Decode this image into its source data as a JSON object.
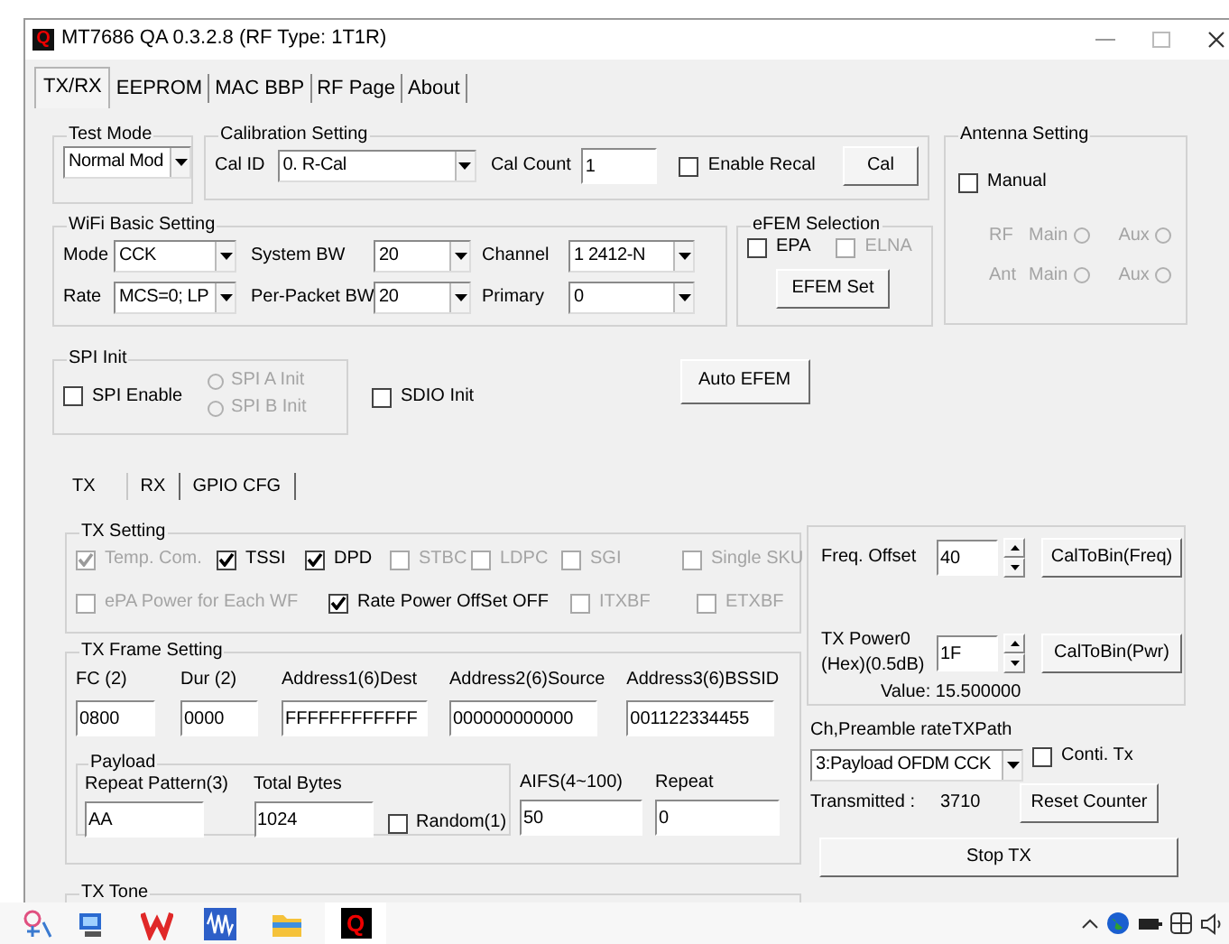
{
  "window": {
    "title": "MT7686 QA 0.3.2.8  (RF Type: 1T1R)",
    "icon_letter": "Q"
  },
  "tabs": [
    {
      "label": "TX/RX",
      "selected": true
    },
    {
      "label": "EEPROM",
      "selected": false
    },
    {
      "label": "MAC  BBP",
      "selected": false
    },
    {
      "label": "RF Page",
      "selected": false
    },
    {
      "label": "About",
      "selected": false
    }
  ],
  "test_mode": {
    "title": "Test Mode",
    "value": "Normal Mod"
  },
  "calibration": {
    "title": "Calibration Setting",
    "cal_id_label": "Cal ID",
    "cal_id": "0. R-Cal",
    "cal_count_label": "Cal Count",
    "cal_count": "1",
    "enable_recal": {
      "label": "Enable Recal",
      "checked": false
    },
    "button": "Cal"
  },
  "antenna": {
    "title": "Antenna Setting",
    "manual": {
      "label": "Manual",
      "checked": false
    },
    "rows": [
      {
        "label": "RF",
        "disabled": true,
        "options": [
          {
            "label": "Main",
            "selected": false
          },
          {
            "label": "Aux",
            "selected": false
          }
        ]
      },
      {
        "label": "Ant",
        "disabled": true,
        "options": [
          {
            "label": "Main",
            "selected": false
          },
          {
            "label": "Aux",
            "selected": false
          }
        ]
      }
    ]
  },
  "wifi_basic": {
    "title": "WiFi Basic Setting",
    "fields": [
      {
        "label": "Mode",
        "value": "CCK"
      },
      {
        "label": "System BW",
        "value": "20"
      },
      {
        "label": "Channel",
        "value": "1  2412-N"
      },
      {
        "label": "Rate",
        "value": "MCS=0;  LP"
      },
      {
        "label": "Per-Packet BW",
        "value": "20"
      },
      {
        "label": "Primary",
        "value": "0"
      }
    ]
  },
  "efem": {
    "title": "eFEM Selection",
    "options": [
      {
        "label": "EPA",
        "checked": false,
        "disabled": false
      },
      {
        "label": "ELNA",
        "checked": false,
        "disabled": true
      }
    ],
    "button": "EFEM Set"
  },
  "spi_init": {
    "title": "SPI Init",
    "enable": {
      "label": "SPI Enable",
      "checked": false
    },
    "options": [
      {
        "label": "SPI A Init",
        "selected": false,
        "disabled": true
      },
      {
        "label": "SPI B Init",
        "selected": false,
        "disabled": true
      }
    ]
  },
  "sdio_init": {
    "label": "SDIO Init",
    "checked": false
  },
  "auto_efem_button": "Auto EFEM",
  "sub_tabs": [
    {
      "label": "TX",
      "selected": true
    },
    {
      "label": "RX",
      "selected": false
    },
    {
      "label": "GPIO CFG",
      "selected": false
    }
  ],
  "tx_setting": {
    "title": "TX Setting",
    "options": [
      {
        "label": "Temp. Com.",
        "checked": true,
        "disabled": true
      },
      {
        "label": "TSSI",
        "checked": true,
        "disabled": false
      },
      {
        "label": "DPD",
        "checked": true,
        "disabled": false
      },
      {
        "label": "STBC",
        "checked": false,
        "disabled": true
      },
      {
        "label": "LDPC",
        "checked": false,
        "disabled": true
      },
      {
        "label": "SGI",
        "checked": false,
        "disabled": true
      },
      {
        "label": "Single SKU",
        "checked": false,
        "disabled": true
      },
      {
        "label": "ePA Power for Each WF",
        "checked": false,
        "disabled": true
      },
      {
        "label": "Rate Power OffSet OFF",
        "checked": true,
        "disabled": false
      },
      {
        "label": "ITXBF",
        "checked": false,
        "disabled": true
      },
      {
        "label": "ETXBF",
        "checked": false,
        "disabled": true
      }
    ]
  },
  "tx_frame": {
    "title": "TX Frame Setting",
    "fields": [
      {
        "label": "FC (2)",
        "value": "0800"
      },
      {
        "label": "Dur (2)",
        "value": "0000"
      },
      {
        "label": "Address1(6)Dest",
        "value": "FFFFFFFFFFFF"
      },
      {
        "label": "Address2(6)Source",
        "value": "000000000000"
      },
      {
        "label": "Address3(6)BSSID",
        "value": "001122334455"
      }
    ],
    "payload": {
      "title": "Payload",
      "fields": [
        {
          "label": "Repeat Pattern(3)",
          "value": "AA"
        },
        {
          "label": "Total Bytes",
          "value": "1024"
        }
      ],
      "random": {
        "label": "Random(1)",
        "checked": false
      }
    },
    "extra_fields": [
      {
        "label": "AIFS(4~100)",
        "value": "50"
      },
      {
        "label": "Repeat",
        "value": "0"
      }
    ]
  },
  "tx_tone": {
    "title": "TX Tone"
  },
  "cal_panel": {
    "freq_label": "Freq. Offset",
    "freq_value": "40",
    "freq_button": "CalToBin(Freq)",
    "power_label": "TX Power0 (Hex)(0.5dB)",
    "power_value": "1F",
    "power_button": "CalToBin(Pwr)",
    "value_text": "Value: 15.500000"
  },
  "tx_path": {
    "label": "Ch,Preamble rateTXPath",
    "value": "3:Payload OFDM CCK",
    "conti_tx": {
      "label": "Conti. Tx",
      "checked": false
    },
    "transmitted_label": "Transmitted :",
    "transmitted": "3710",
    "reset_button": "Reset Counter",
    "stop_button": "Stop TX"
  },
  "taskbar": {
    "active_app_letter": "Q"
  }
}
